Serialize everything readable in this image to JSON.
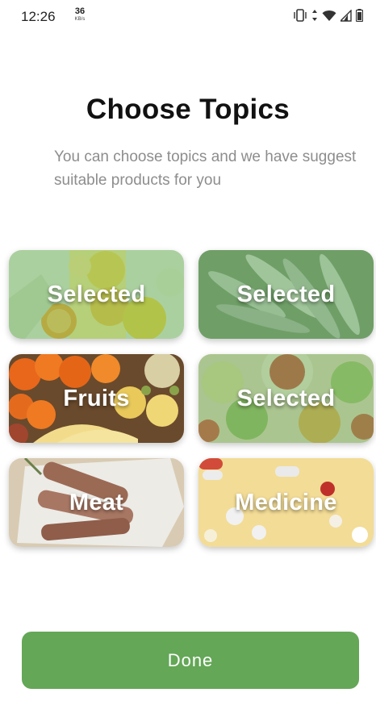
{
  "status_bar": {
    "time": "12:26",
    "speed_value": "36",
    "speed_unit": "KB/s",
    "icons": [
      "vibrate-icon",
      "data-arrows-icon",
      "wifi-icon",
      "cell-signal-icon",
      "battery-icon"
    ]
  },
  "header": {
    "title": "Choose Topics",
    "subtitle": "You can choose topics and we have suggest suitable products for you"
  },
  "topics": [
    {
      "label": "Selected",
      "image": "citrus-fruits",
      "selected": true
    },
    {
      "label": "Selected",
      "image": "fish",
      "selected": true
    },
    {
      "label": "Fruits",
      "image": "assorted-fruits",
      "selected": false
    },
    {
      "label": "Selected",
      "image": "salad-bowls",
      "selected": true
    },
    {
      "label": "Meat",
      "image": "grilled-meat",
      "selected": false
    },
    {
      "label": "Medicine",
      "image": "pills",
      "selected": false
    }
  ],
  "actions": {
    "done_label": "Done"
  },
  "colors": {
    "accent": "#64a757",
    "selected_overlay": "#6eb45f",
    "subtitle_text": "#8d8d8d"
  }
}
